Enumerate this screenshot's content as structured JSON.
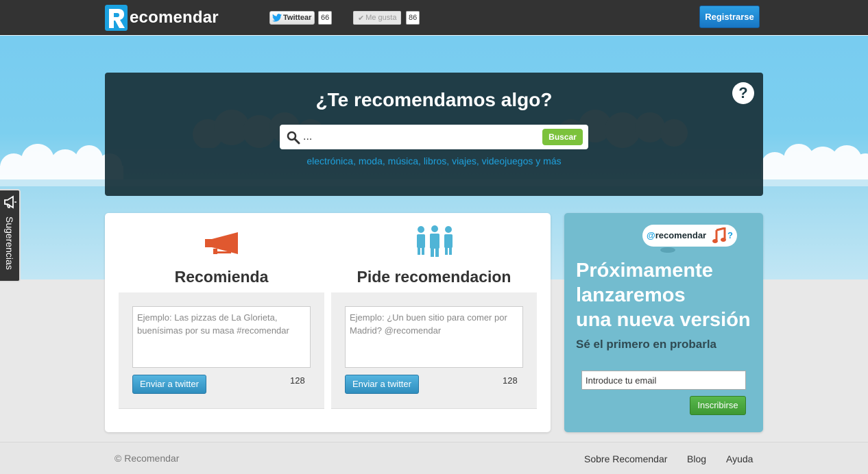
{
  "header": {
    "logo_text": "ecomendar",
    "tweet_label": "Twittear",
    "tweet_count": "66",
    "like_label": "Me gusta",
    "like_count": "86",
    "register_label": "Registrarse"
  },
  "hero": {
    "title": "¿Te recomendamos algo?",
    "search_placeholder": "...",
    "search_button": "Buscar",
    "categories": [
      "electrónica",
      "moda",
      "música",
      "libros",
      "viajes",
      "videojuegos"
    ],
    "categories_suffix": "y más",
    "help_label": "?"
  },
  "sidebar_tab": {
    "label": "Sugerencias"
  },
  "recommend": {
    "title": "Recomienda",
    "placeholder": "Ejemplo: Las pizzas de La Glorieta, buenísimas por su masa #recomendar",
    "send_label": "Enviar a twitter",
    "char_count": "128"
  },
  "ask": {
    "title": "Pide recomendacion",
    "placeholder": "Ejemplo: ¿Un buen sitio para comer por Madrid? @recomendar",
    "send_label": "Enviar a twitter",
    "char_count": "128"
  },
  "promo": {
    "bubble_at": "@",
    "bubble_text": "recomendar",
    "bubble_q": "?",
    "headline_lines": [
      "Próximamente",
      "lanzaremos",
      "una nueva versión"
    ],
    "subtitle": "Sé el primero en probarla",
    "email_placeholder": "Introduce tu email",
    "subscribe_label": "Inscribirse"
  },
  "footer": {
    "copyright": "© Recomendar",
    "links": [
      "Sobre Recomendar",
      "Blog",
      "Ayuda"
    ]
  },
  "colors": {
    "topbar": "#333333",
    "brand_blue": "#1aa1e1",
    "hero_bg": "#19323a",
    "accent_orange": "#e0582f",
    "people_blue": "#4fb4d6",
    "promo_bg": "#73bccf",
    "green": "#7cc23c"
  },
  "icons": [
    "logo-r-icon",
    "twitter-bird-icon",
    "checkmark-icon",
    "search-icon",
    "help-icon",
    "megaphone-icon",
    "people-group-icon",
    "music-note-icon"
  ]
}
